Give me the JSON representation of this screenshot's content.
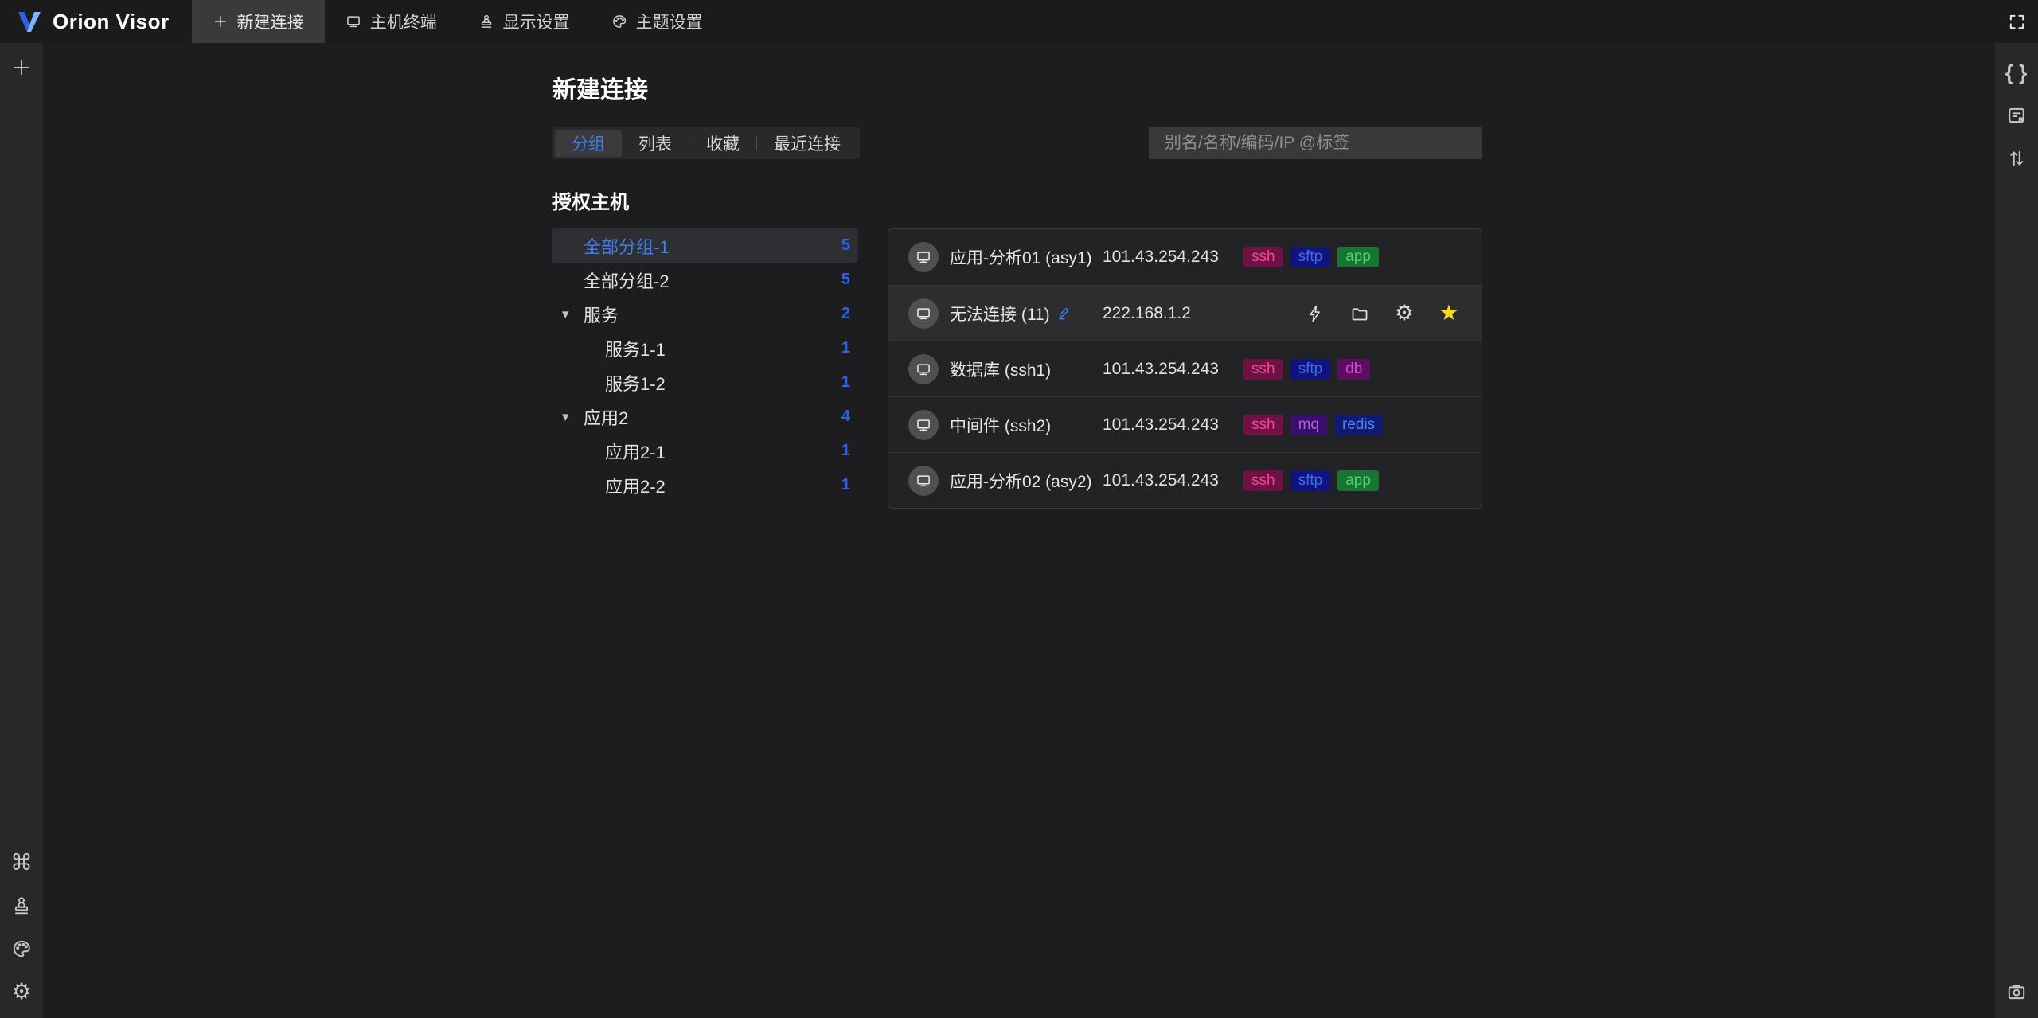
{
  "theme": {
    "accent": "#3f7ef2",
    "count_blue": "#2a62ee",
    "star_yellow": "#fadb14"
  },
  "topbar": {
    "logo": {
      "text": "Orion Visor",
      "icon": "orion-logo"
    },
    "tabs": [
      {
        "name": "new-connection",
        "icon": "plus-icon",
        "label": "新建连接",
        "active": true
      },
      {
        "name": "host-terminal",
        "icon": "monitor-icon",
        "label": "主机终端",
        "active": false
      },
      {
        "name": "display-settings",
        "icon": "stamp-icon",
        "label": "显示设置",
        "active": false
      },
      {
        "name": "theme-settings",
        "icon": "palette-icon",
        "label": "主题设置",
        "active": false
      }
    ],
    "fullscreen_icon": "fullscreen-icon"
  },
  "left_sidebar": {
    "top_icons": [
      {
        "name": "add-button",
        "icon": "plus-icon"
      }
    ],
    "bottom_icons": [
      {
        "name": "command-shortcuts-button",
        "icon": "command-icon"
      },
      {
        "name": "display-settings-button",
        "icon": "stamp-icon"
      },
      {
        "name": "theme-settings-button",
        "icon": "palette-icon"
      },
      {
        "name": "settings-button",
        "icon": "gear-icon"
      }
    ]
  },
  "right_sidebar": {
    "top_icons": [
      {
        "name": "json-view-button",
        "icon": "braces-icon"
      },
      {
        "name": "bookmark-doc-button",
        "icon": "document-bookmark-icon"
      },
      {
        "name": "sort-order-button",
        "icon": "sort-arrows-icon"
      }
    ],
    "bottom_icons": [
      {
        "name": "screenshot-button",
        "icon": "camera-icon"
      }
    ]
  },
  "main": {
    "title": "新建连接",
    "view_tabs": [
      {
        "name": "grouping",
        "label": "分组",
        "active": true
      },
      {
        "name": "list",
        "label": "列表",
        "active": false
      },
      {
        "name": "favorites",
        "label": "收藏",
        "active": false
      },
      {
        "name": "recent",
        "label": "最近连接",
        "active": false
      }
    ],
    "search": {
      "placeholder": "别名/名称/编码/IP @标签"
    },
    "tree": {
      "heading": "授权主机",
      "items": [
        {
          "label": "全部分组-1",
          "count": "5",
          "level": 0,
          "selected": true
        },
        {
          "label": "全部分组-2",
          "count": "5",
          "level": 0
        },
        {
          "label": "服务",
          "count": "2",
          "level": 0,
          "expanded": true
        },
        {
          "label": "服务1-1",
          "count": "1",
          "level": 1
        },
        {
          "label": "服务1-2",
          "count": "1",
          "level": 1
        },
        {
          "label": "应用2",
          "count": "4",
          "level": 0,
          "expanded": true
        },
        {
          "label": "应用2-1",
          "count": "1",
          "level": 1
        },
        {
          "label": "应用2-2",
          "count": "1",
          "level": 1
        }
      ]
    },
    "avatar_icon": "monitor-icon",
    "hosts": [
      {
        "name": "应用-分析01 (asy1)",
        "ip": "101.43.254.243",
        "tags": [
          {
            "label": "ssh",
            "bg": "#6e1145",
            "fg": "#f9468b"
          },
          {
            "label": "sftp",
            "bg": "#11147d",
            "fg": "#3a6ff2"
          },
          {
            "label": "app",
            "bg": "#177434",
            "fg": "#4ed467"
          }
        ]
      },
      {
        "name": "无法连接 (11)",
        "ip": "222.168.1.2",
        "hovered": true,
        "edit_icon": "pencil-icon",
        "actions": [
          {
            "name": "connect-terminal-button",
            "icon": "bolt-icon"
          },
          {
            "name": "sftp-files-button",
            "icon": "folder-icon"
          },
          {
            "name": "host-settings-button",
            "icon": "gear-icon"
          },
          {
            "name": "favorite-button",
            "icon": "star-icon",
            "color": "#fadb14"
          }
        ]
      },
      {
        "name": "数据库 (ssh1)",
        "ip": "101.43.254.243",
        "tags": [
          {
            "label": "ssh",
            "bg": "#6e1145",
            "fg": "#f9468b"
          },
          {
            "label": "sftp",
            "bg": "#11147d",
            "fg": "#3a6ff2"
          },
          {
            "label": "db",
            "bg": "#5a0f62",
            "fg": "#e146d3"
          }
        ]
      },
      {
        "name": "中间件 (ssh2)",
        "ip": "101.43.254.243",
        "tags": [
          {
            "label": "ssh",
            "bg": "#6e1145",
            "fg": "#f9468b"
          },
          {
            "label": "mq",
            "bg": "#36106b",
            "fg": "#b85ae0"
          },
          {
            "label": "redis",
            "bg": "#101a6e",
            "fg": "#4b85f5"
          }
        ]
      },
      {
        "name": "应用-分析02 (asy2)",
        "ip": "101.43.254.243",
        "tags": [
          {
            "label": "ssh",
            "bg": "#6e1145",
            "fg": "#f9468b"
          },
          {
            "label": "sftp",
            "bg": "#11147d",
            "fg": "#3a6ff2"
          },
          {
            "label": "app",
            "bg": "#177434",
            "fg": "#4ed467"
          }
        ]
      }
    ]
  }
}
